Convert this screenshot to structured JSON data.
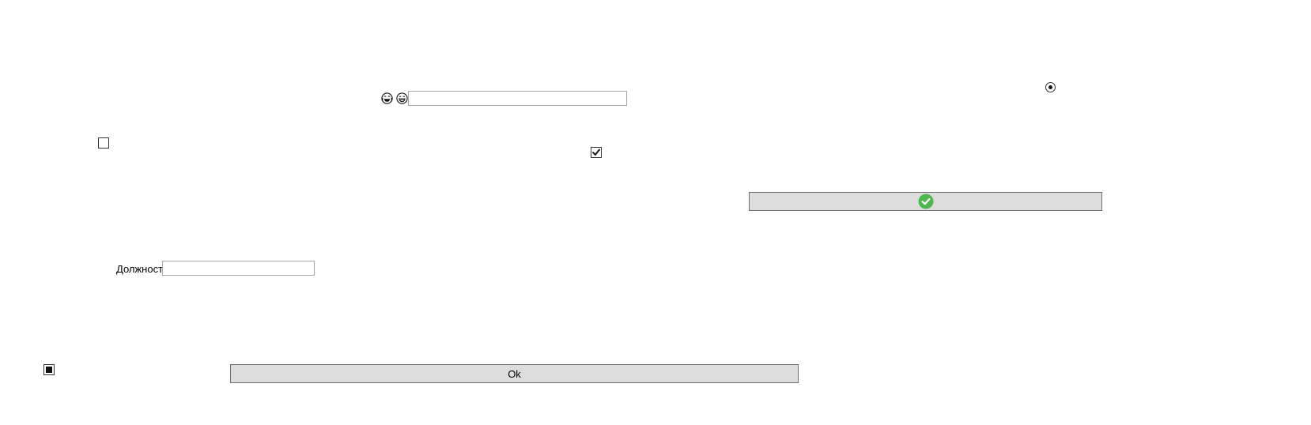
{
  "emoji_icons": {
    "first": "laughing-tears-face-icon",
    "second": "grinning-face-icon"
  },
  "position_field": {
    "label": "Должность",
    "value": "",
    "placeholder": ""
  },
  "top_input": {
    "value": "",
    "placeholder": ""
  },
  "checkboxes": {
    "top_left": "unchecked",
    "middle": "checked",
    "bottom_left": "indeterminate"
  },
  "radio": {
    "selected": true
  },
  "confirm_button": {
    "icon": "green-check-circle-icon",
    "color": "#4fb74f"
  },
  "ok_button": {
    "label": "Ok"
  }
}
